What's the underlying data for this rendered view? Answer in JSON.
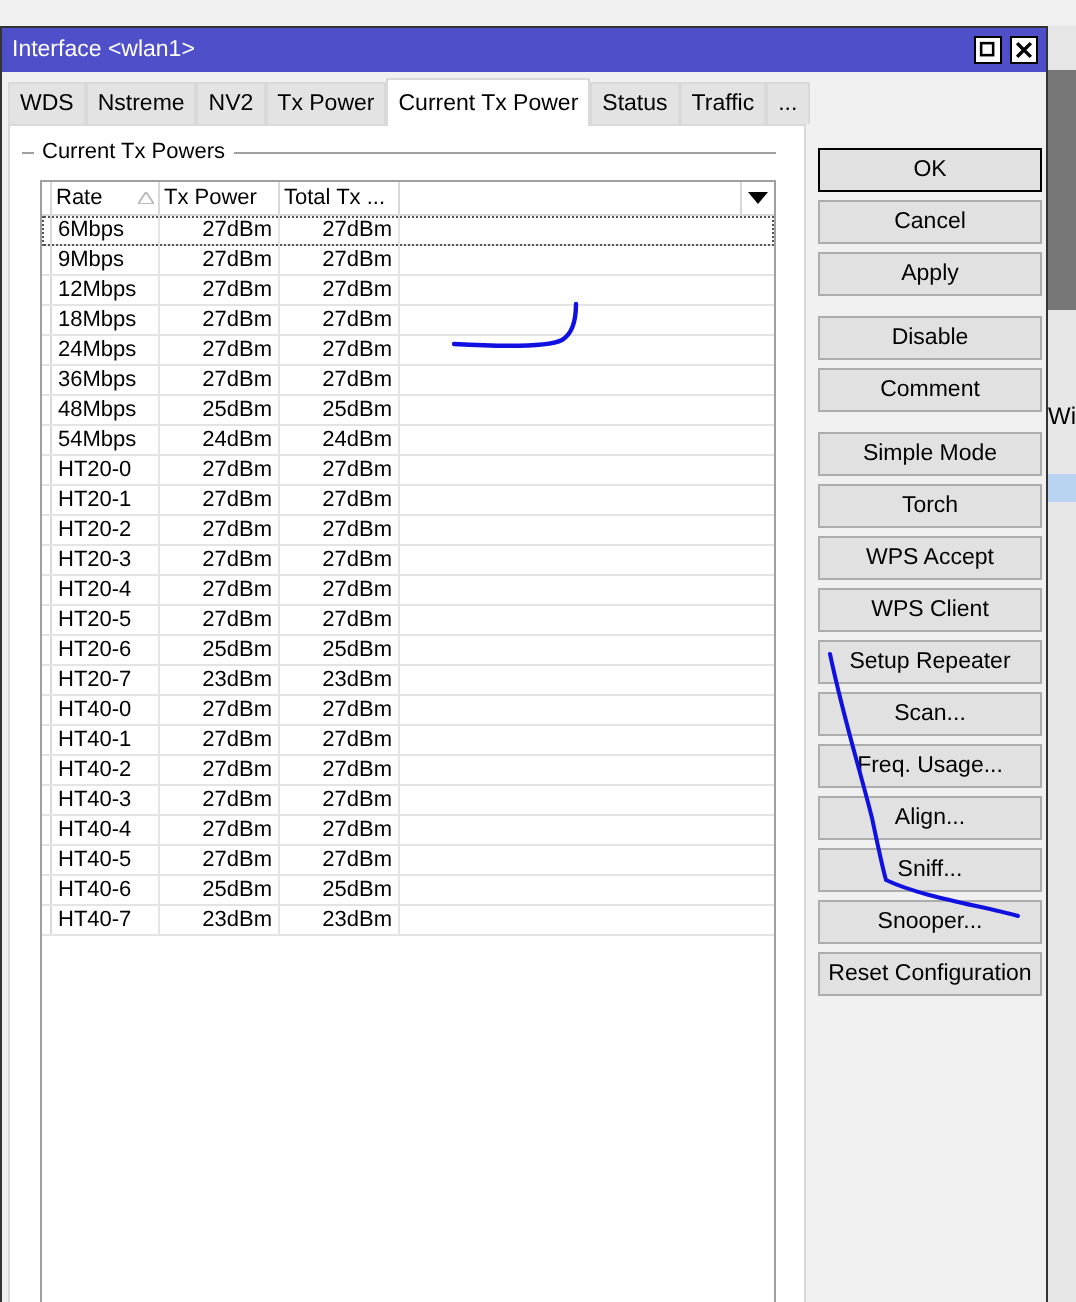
{
  "window": {
    "title": "Interface <wlan1>"
  },
  "tabs": [
    {
      "label": "WDS",
      "selected": false
    },
    {
      "label": "Nstreme",
      "selected": false
    },
    {
      "label": "NV2",
      "selected": false
    },
    {
      "label": "Tx Power",
      "selected": false
    },
    {
      "label": "Current Tx Power",
      "selected": true
    },
    {
      "label": "Status",
      "selected": false
    },
    {
      "label": "Traffic",
      "selected": false
    },
    {
      "label": "...",
      "selected": false
    }
  ],
  "group": {
    "title": "Current Tx Powers"
  },
  "table": {
    "columns": [
      "Rate",
      "Tx Power",
      "Total Tx ..."
    ],
    "rows": [
      {
        "cells": [
          "6Mbps",
          "27dBm",
          "27dBm"
        ],
        "focused": true
      },
      {
        "cells": [
          "9Mbps",
          "27dBm",
          "27dBm"
        ],
        "focused": false
      },
      {
        "cells": [
          "12Mbps",
          "27dBm",
          "27dBm"
        ],
        "focused": false
      },
      {
        "cells": [
          "18Mbps",
          "27dBm",
          "27dBm"
        ],
        "focused": false
      },
      {
        "cells": [
          "24Mbps",
          "27dBm",
          "27dBm"
        ],
        "focused": false
      },
      {
        "cells": [
          "36Mbps",
          "27dBm",
          "27dBm"
        ],
        "focused": false
      },
      {
        "cells": [
          "48Mbps",
          "25dBm",
          "25dBm"
        ],
        "focused": false
      },
      {
        "cells": [
          "54Mbps",
          "24dBm",
          "24dBm"
        ],
        "focused": false
      },
      {
        "cells": [
          "HT20-0",
          "27dBm",
          "27dBm"
        ],
        "focused": false
      },
      {
        "cells": [
          "HT20-1",
          "27dBm",
          "27dBm"
        ],
        "focused": false
      },
      {
        "cells": [
          "HT20-2",
          "27dBm",
          "27dBm"
        ],
        "focused": false
      },
      {
        "cells": [
          "HT20-3",
          "27dBm",
          "27dBm"
        ],
        "focused": false
      },
      {
        "cells": [
          "HT20-4",
          "27dBm",
          "27dBm"
        ],
        "focused": false
      },
      {
        "cells": [
          "HT20-5",
          "27dBm",
          "27dBm"
        ],
        "focused": false
      },
      {
        "cells": [
          "HT20-6",
          "25dBm",
          "25dBm"
        ],
        "focused": false
      },
      {
        "cells": [
          "HT20-7",
          "23dBm",
          "23dBm"
        ],
        "focused": false
      },
      {
        "cells": [
          "HT40-0",
          "27dBm",
          "27dBm"
        ],
        "focused": false
      },
      {
        "cells": [
          "HT40-1",
          "27dBm",
          "27dBm"
        ],
        "focused": false
      },
      {
        "cells": [
          "HT40-2",
          "27dBm",
          "27dBm"
        ],
        "focused": false
      },
      {
        "cells": [
          "HT40-3",
          "27dBm",
          "27dBm"
        ],
        "focused": false
      },
      {
        "cells": [
          "HT40-4",
          "27dBm",
          "27dBm"
        ],
        "focused": false
      },
      {
        "cells": [
          "HT40-5",
          "27dBm",
          "27dBm"
        ],
        "focused": false
      },
      {
        "cells": [
          "HT40-6",
          "25dBm",
          "25dBm"
        ],
        "focused": false
      },
      {
        "cells": [
          "HT40-7",
          "23dBm",
          "23dBm"
        ],
        "focused": false
      }
    ]
  },
  "button_groups": [
    [
      {
        "label": "OK",
        "default": true
      },
      {
        "label": "Cancel",
        "default": false
      },
      {
        "label": "Apply",
        "default": false
      }
    ],
    [
      {
        "label": "Disable",
        "default": false
      },
      {
        "label": "Comment",
        "default": false
      }
    ],
    [
      {
        "label": "Simple Mode",
        "default": false
      },
      {
        "label": "Torch",
        "default": false
      },
      {
        "label": "WPS Accept",
        "default": false
      },
      {
        "label": "WPS Client",
        "default": false
      },
      {
        "label": "Setup Repeater",
        "default": false
      },
      {
        "label": "Scan...",
        "default": false
      },
      {
        "label": "Freq. Usage...",
        "default": false
      },
      {
        "label": "Align...",
        "default": false
      },
      {
        "label": "Sniff...",
        "default": false
      },
      {
        "label": "Snooper...",
        "default": false
      },
      {
        "label": "Reset Configuration",
        "default": false
      }
    ]
  ],
  "background_window": {
    "text": "Wi"
  }
}
